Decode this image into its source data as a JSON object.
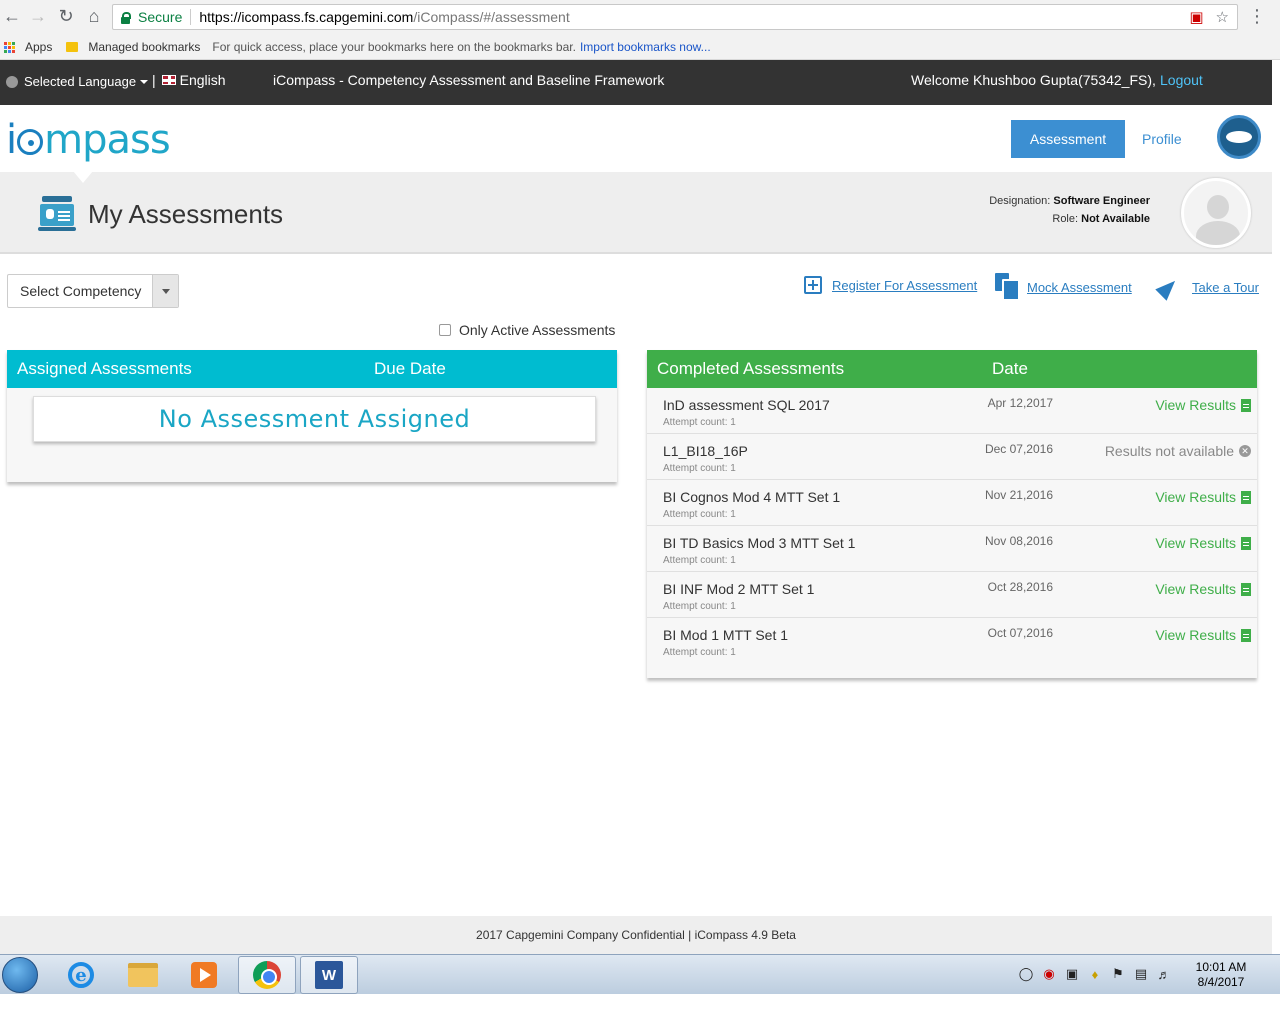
{
  "browser": {
    "secure_label": "Secure",
    "url_host": "https://icompass.fs.capgemini.com",
    "url_path": "/iCompass/#/assessment",
    "bookmarks": {
      "apps_label": "Apps",
      "managed_label": "Managed bookmarks",
      "hint": "For quick access, place your bookmarks here on the bookmarks bar.",
      "import_link": "Import bookmarks now..."
    }
  },
  "topbar": {
    "language_label": "Selected Language",
    "language_value": "English",
    "app_title": "iCompass - Competency Assessment and Baseline Framework",
    "welcome": "Welcome Khushboo Gupta(75342_FS),",
    "logout": "Logout"
  },
  "header": {
    "logo_i": "i",
    "logo_rest": "mpass",
    "assessment_btn": "Assessment",
    "profile_link": "Profile"
  },
  "banner": {
    "title": "My Assessments",
    "designation_label": "Designation:",
    "designation_value": "Software Engineer",
    "role_label": "Role:",
    "role_value": "Not Available"
  },
  "toolbar": {
    "select_competency": "Select Competency",
    "register": "Register For Assessment",
    "mock": "Mock Assessment",
    "tour": "Take a Tour",
    "only_active": "Only Active Assessments"
  },
  "assigned": {
    "col_title": "Assigned Assessments",
    "col_date": "Due Date",
    "empty_message": "No Assessment Assigned"
  },
  "completed": {
    "col_title": "Completed Assessments",
    "col_date": "Date",
    "rows": [
      {
        "name": "InD assessment SQL 2017",
        "count": "Attempt count: 1",
        "date": "Apr 12,2017",
        "result": "View Results"
      },
      {
        "name": "L1_BI18_16P",
        "count": "Attempt count: 1",
        "date": "Dec 07,2016",
        "result": "Results not available"
      },
      {
        "name": "BI Cognos Mod 4 MTT Set 1",
        "count": "Attempt count: 1",
        "date": "Nov 21,2016",
        "result": "View Results"
      },
      {
        "name": "BI TD Basics Mod 3 MTT Set 1",
        "count": "Attempt count: 1",
        "date": "Nov 08,2016",
        "result": "View Results"
      },
      {
        "name": "BI INF Mod 2 MTT Set 1",
        "count": "Attempt count: 1",
        "date": "Oct 28,2016",
        "result": "View Results"
      },
      {
        "name": "BI Mod 1 MTT Set 1",
        "count": "Attempt count: 1",
        "date": "Oct 07,2016",
        "result": "View Results"
      }
    ]
  },
  "footer": {
    "text": "2017 Capgemini Company Confidential | iCompass 4.9 Beta"
  },
  "taskbar": {
    "time": "10:01 AM",
    "date": "8/4/2017",
    "word_label": "W"
  },
  "colors": {
    "assigned_header": "#00bcd0",
    "completed_header": "#3fae49",
    "primary_button": "#3c8fd2",
    "topbar": "#333333"
  }
}
